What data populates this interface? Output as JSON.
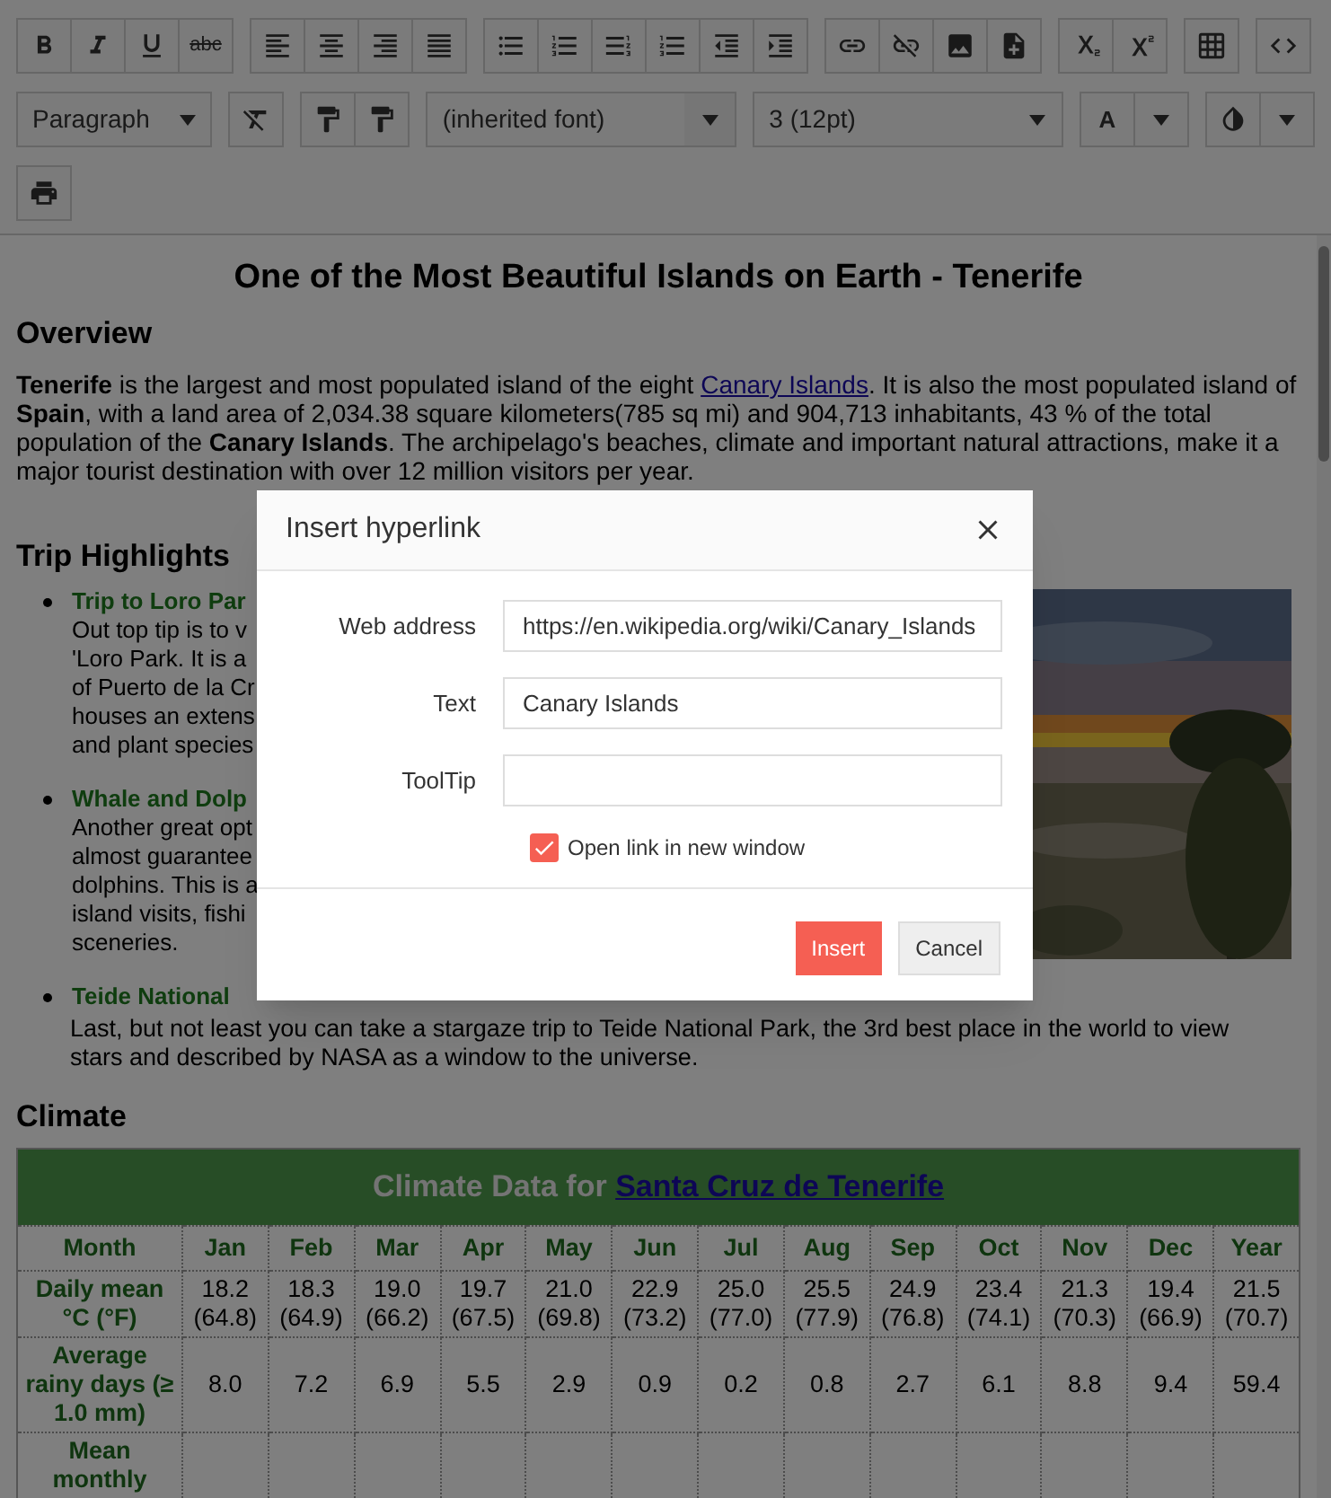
{
  "toolbar": {
    "strike_label": "abc",
    "block_format": "Paragraph",
    "font": "(inherited font)",
    "font_size": "3 (12pt)",
    "text_color_label": "A"
  },
  "document": {
    "title": "One of the Most Beautiful Islands on Earth - Tenerife",
    "overview": {
      "heading": "Overview",
      "before_link": "**Tenerife** is the largest and most populated island of the eight ",
      "link": "Canary Islands",
      "after_link": ". It is also the most populated island of **Spain**, with a land area of 2,034.38 square kilometers(785 sq mi) and 904,713 inhabitants, 43 % of the total population of the **Canary Islands**. The archipelago's beaches, climate and important natural attractions, make it a major tourist destination with over 12 million visitors per year."
    },
    "highlights": {
      "heading": "Trip Highlights",
      "items": [
        {
          "heading": "Trip to Loro Par",
          "lines": [
            "Out top tip is to v",
            "'Loro Park. It is a",
            "of Puerto de la Cr",
            "houses an extens",
            "and plant species"
          ]
        },
        {
          "heading": "Whale and Dolp",
          "lines": [
            "Another great opt",
            "almost guarantee",
            "dolphins. This is a",
            "island visits, fishi",
            "sceneries."
          ]
        },
        {
          "heading": "Teide National",
          "lines": [
            "Last, but not least you can take a stargaze trip to Teide National Park, the 3rd best place in the world to view",
            "stars and described by NASA as a window to the universe."
          ]
        }
      ]
    },
    "climate": {
      "heading": "Climate",
      "caption_prefix": "Climate Data for",
      "caption_link": "Santa Cruz de Tenerife",
      "columns": [
        "Month",
        "Jan",
        "Feb",
        "Mar",
        "Apr",
        "May",
        "Jun",
        "Jul",
        "Aug",
        "Sep",
        "Oct",
        "Nov",
        "Dec",
        "Year"
      ],
      "rows": [
        {
          "header": "Daily mean °C (°F)",
          "cells": [
            "18.2 (64.8)",
            "18.3 (64.9)",
            "19.0 (66.2)",
            "19.7 (67.5)",
            "21.0 (69.8)",
            "22.9 (73.2)",
            "25.0 (77.0)",
            "25.5 (77.9)",
            "24.9 (76.8)",
            "23.4 (74.1)",
            "21.3 (70.3)",
            "19.4 (66.9)",
            "21.5 (70.7)"
          ]
        },
        {
          "header": "Average rainy days (≥ 1.0 mm)",
          "cells": [
            "8.0",
            "7.2",
            "6.9",
            "5.5",
            "2.9",
            "0.9",
            "0.2",
            "0.8",
            "2.7",
            "6.1",
            "8.8",
            "9.4",
            "59.4"
          ]
        },
        {
          "header": "Mean monthly"
        }
      ]
    }
  },
  "dialog": {
    "title": "Insert hyperlink",
    "fields": [
      {
        "label": "Web address",
        "value": "https://en.wikipedia.org/wiki/Canary_Islands"
      },
      {
        "label": "Text",
        "value": "Canary Islands"
      },
      {
        "label": "ToolTip"
      }
    ],
    "new_window": {
      "label": "Open link in new window",
      "checked": true
    },
    "buttons": [
      {
        "label": "Insert",
        "kind": "primary"
      },
      {
        "label": "Cancel",
        "kind": "secondary"
      }
    ]
  }
}
